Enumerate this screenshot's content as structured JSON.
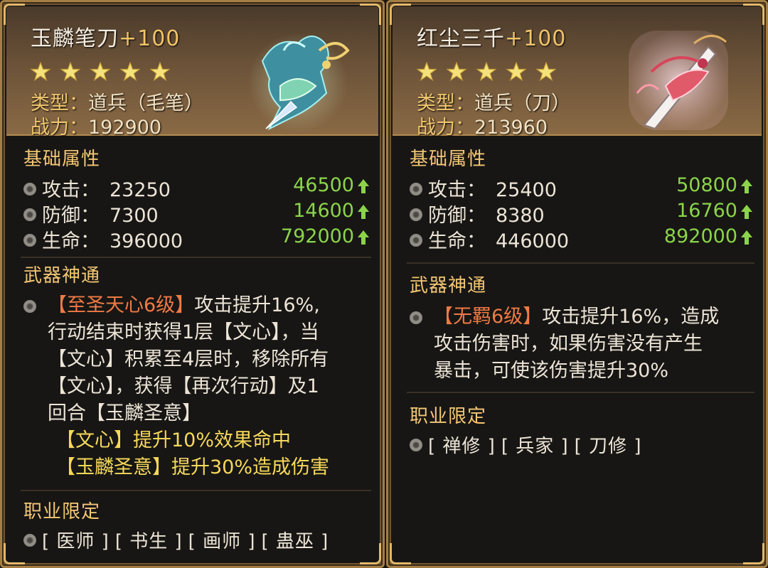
{
  "cards": [
    {
      "name": "玉麟笔刀",
      "plus": "+100",
      "stars": 5,
      "type_key": "类型：",
      "type_value": "道兵（毛笔）",
      "power_key": "战力：",
      "power_value": "192900",
      "base_title": "基础属性",
      "attributes": [
        {
          "label": "攻击：",
          "value": "23250",
          "boost": "46500"
        },
        {
          "label": "防御：",
          "value": "7300",
          "boost": "14600"
        },
        {
          "label": "生命：",
          "value": "396000",
          "boost": "792000"
        }
      ],
      "skill_title": "武器神通",
      "skill_name": "【至圣天心6级】",
      "skill_desc_first": "攻击提升16%,",
      "skill_lines": [
        "行动结束时获得1层【文心】，当",
        "【文心】积累至4层时，移除所有",
        "【文心】，获得【再次行动】及1",
        "回合【玉麟圣意】"
      ],
      "skill_extra": [
        "【文心】提升10%效果命中",
        "【玉麟圣意】提升30%造成伤害"
      ],
      "class_title": "职业限定",
      "classes": [
        "[ 医师 ]",
        "[ 书生 ]",
        "[ 画师 ]",
        "[ 蛊巫 ]"
      ]
    },
    {
      "name": "红尘三千",
      "plus": "+100",
      "stars": 5,
      "type_key": "类型：",
      "type_value": "道兵（刀）",
      "power_key": "战力：",
      "power_value": "213960",
      "base_title": "基础属性",
      "attributes": [
        {
          "label": "攻击：",
          "value": "25400",
          "boost": "50800"
        },
        {
          "label": "防御：",
          "value": "8380",
          "boost": "16760"
        },
        {
          "label": "生命：",
          "value": "446000",
          "boost": "892000"
        }
      ],
      "skill_title": "武器神通",
      "skill_name": "【无羁6级】",
      "skill_desc_first": "攻击提升16%，造成",
      "skill_lines": [
        "攻击伤害时，如果伤害没有产生",
        "暴击，可使该伤害提升30%"
      ],
      "skill_extra": [],
      "class_title": "职业限定",
      "classes": [
        "[ 禅修 ]",
        "[ 兵家 ]",
        "[ 刀修 ]"
      ]
    }
  ],
  "colors": {
    "title_accent": "#f0c36a",
    "section": "#f4c774",
    "boost": "#8bd44a",
    "skill_name": "#f07a45",
    "skill_extra": "#f6d85a"
  },
  "icons": {
    "star": "star-icon",
    "bullet": "swirl-bullet-icon",
    "arrow": "green-up-arrow-icon",
    "art_left": "jade-qilin-brush-blade-icon",
    "art_right": "red-dust-sabre-icon"
  }
}
